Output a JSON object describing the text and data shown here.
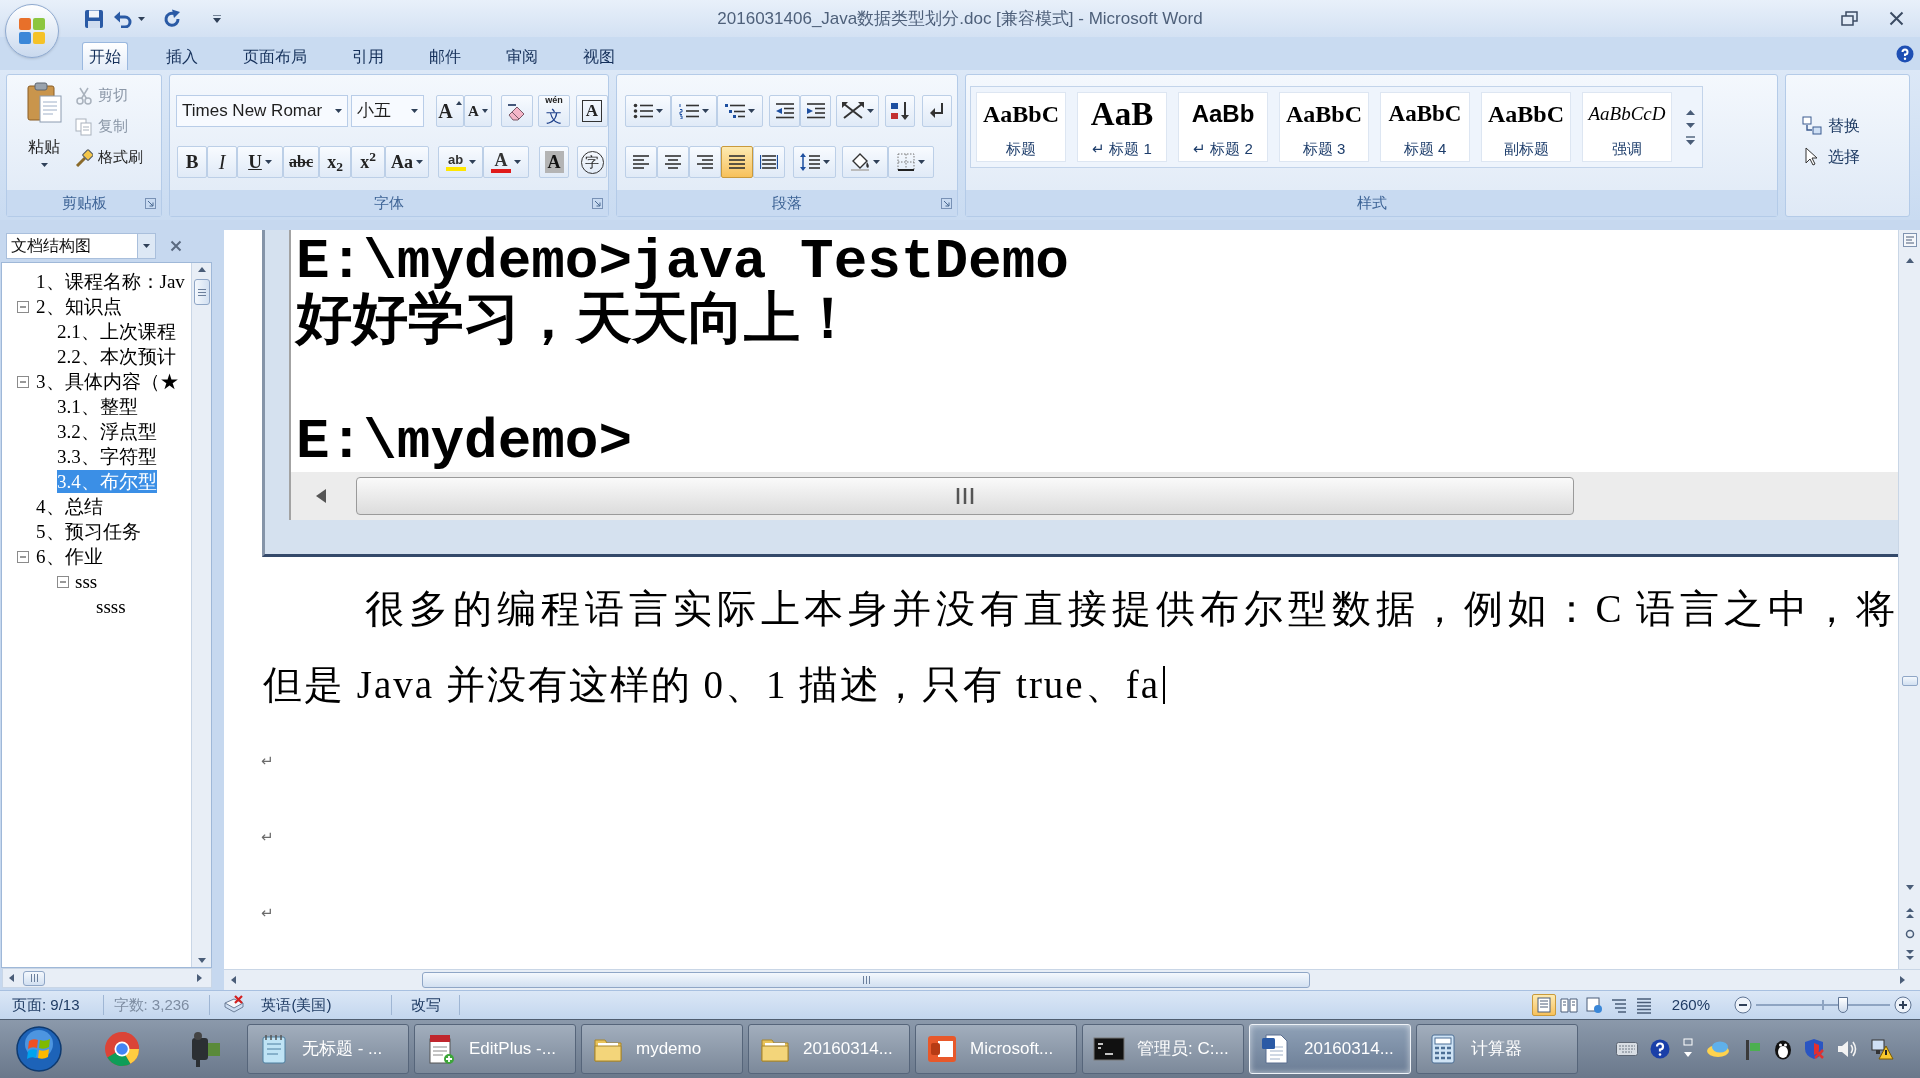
{
  "window": {
    "title": "2016031406_Java数据类型划分.doc [兼容模式] - Microsoft Word"
  },
  "ribbon": {
    "tabs": [
      {
        "label": "开始",
        "selected": true
      },
      {
        "label": "插入",
        "selected": false
      },
      {
        "label": "页面布局",
        "selected": false
      },
      {
        "label": "引用",
        "selected": false
      },
      {
        "label": "邮件",
        "selected": false
      },
      {
        "label": "审阅",
        "selected": false
      },
      {
        "label": "视图",
        "selected": false
      }
    ],
    "clipboard": {
      "label": "剪贴板",
      "paste": "粘贴",
      "commands": [
        {
          "label": "剪切",
          "disabled": true
        },
        {
          "label": "复制",
          "disabled": true
        },
        {
          "label": "格式刷",
          "disabled": false
        }
      ]
    },
    "font": {
      "label": "字体",
      "name": "Times New Romar",
      "size": "小五",
      "size_buttons": [
        "A",
        "A"
      ],
      "phonetic": [
        "wén",
        "文"
      ],
      "border_letter": "A",
      "formats": [
        "B",
        "I",
        "U",
        "abc",
        "x$_{2}$",
        "x$^{2}$",
        "Aa"
      ],
      "highlight": "ab",
      "color_letter": "A",
      "shading_letter": "A",
      "enclose": "字"
    },
    "paragraph": {
      "label": "段落",
      "alignments": [
        {
          "selected": false
        },
        {
          "selected": false
        },
        {
          "selected": false
        },
        {
          "selected": true
        },
        {
          "selected": false
        }
      ]
    },
    "styles": {
      "label": "样式",
      "items": [
        {
          "sample": "AaBbC",
          "label": "标题"
        },
        {
          "sample": "AaB",
          "label": "↵ 标题 1"
        },
        {
          "sample": "AaBb",
          "label": "↵ 标题 2"
        },
        {
          "sample": "AaBbC",
          "label": "标题 3"
        },
        {
          "sample": "AaBbC",
          "label": "标题 4"
        },
        {
          "sample": "AaBbC",
          "label": "副标题"
        },
        {
          "sample": "AaBbCcD",
          "label": "强调"
        }
      ]
    },
    "editing": {
      "commands": [
        "替换",
        "选择"
      ]
    }
  },
  "document_map": {
    "title": "文档结构图",
    "items": [
      {
        "label": "1、课程名称：Jav",
        "selected": false
      },
      {
        "label": "2、知识点",
        "selected": false,
        "expanded": true,
        "children": [
          {
            "label": "2.1、上次课程",
            "selected": false
          },
          {
            "label": "2.2、本次预计",
            "selected": false
          }
        ]
      },
      {
        "label": "3、具体内容（★",
        "selected": false,
        "expanded": true,
        "children": [
          {
            "label": "3.1、整型",
            "selected": false
          },
          {
            "label": "3.2、浮点型",
            "selected": false
          },
          {
            "label": "3.3、字符型",
            "selected": false
          },
          {
            "label": "3.4、布尔型",
            "selected": true
          }
        ]
      },
      {
        "label": "4、总结",
        "selected": false
      },
      {
        "label": "5、预习任务",
        "selected": false
      },
      {
        "label": "6、作业",
        "selected": false,
        "expanded": true,
        "children": [
          {
            "label": "sss",
            "selected": false,
            "expanded": true,
            "children": [
              {
                "label": "ssss",
                "selected": false
              }
            ]
          }
        ]
      }
    ]
  },
  "document": {
    "console_lines": [
      {
        "kind": "text",
        "text": "E:\\mydemo>java TestDemo"
      },
      {
        "kind": "text",
        "text": "好好学习，天天向上！"
      },
      {
        "kind": "blank"
      },
      {
        "kind": "text",
        "text": "E:\\mydemo>"
      }
    ],
    "body_lines": [
      "很多的编程语言实际上本身并没有直接提供布尔型数据，例如：C 语言之中，将",
      "但是 Java 并没有这样的 0、1 描述，只有 true、fa"
    ],
    "paragraph_marks": [
      "↵",
      "↵",
      "↵"
    ]
  },
  "status_bar": {
    "page": "页面: 9/13",
    "word_count": "字数: 3,236",
    "language": "英语(美国)",
    "mode": "改写",
    "views": [
      {
        "selected": true
      },
      {
        "selected": false
      },
      {
        "selected": false
      },
      {
        "selected": false
      },
      {
        "selected": false
      }
    ],
    "zoom": {
      "reading": "260%",
      "level": 0.65
    }
  },
  "taskbar": {
    "buttons": [
      {
        "label": "无标题 - ...",
        "selected": false
      },
      {
        "label": "EditPlus -...",
        "selected": false
      },
      {
        "label": "mydemo",
        "selected": false
      },
      {
        "label": "20160314...",
        "selected": false
      },
      {
        "label": "Microsoft...",
        "selected": false
      },
      {
        "label": "管理员: C:...",
        "selected": false
      },
      {
        "label": "20160314...",
        "selected": true
      },
      {
        "label": "计算器",
        "selected": false
      }
    ]
  }
}
